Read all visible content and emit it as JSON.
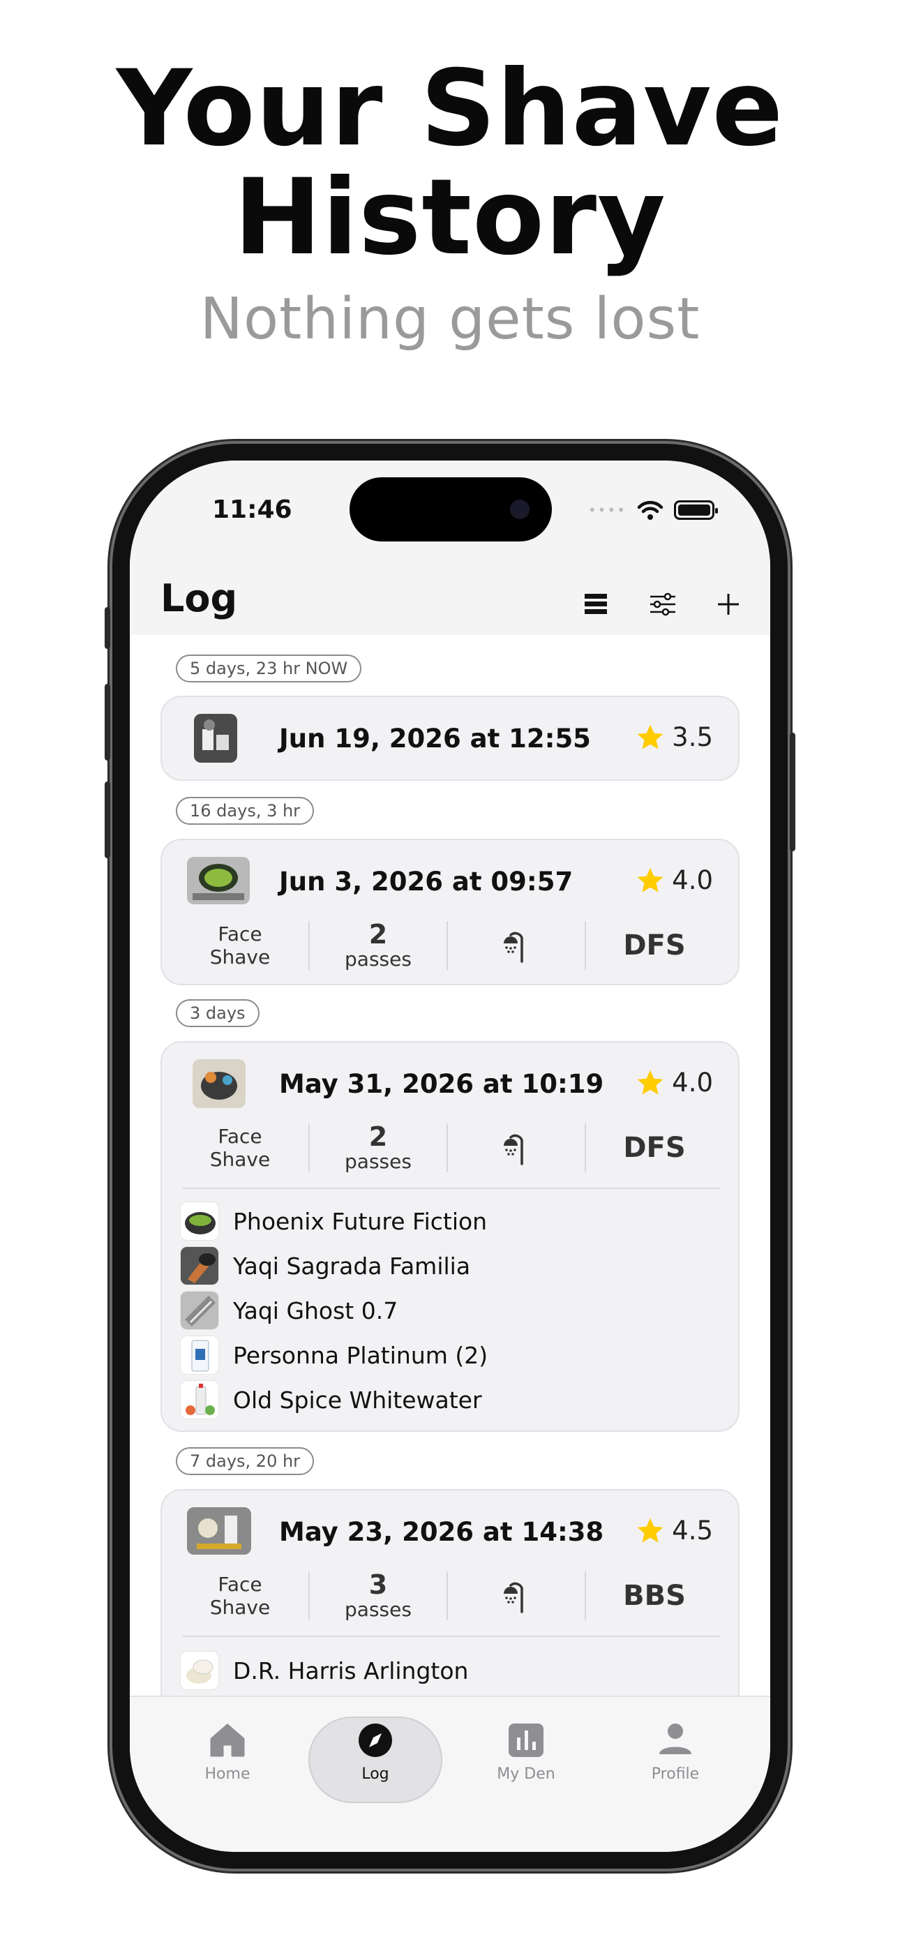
{
  "hero": {
    "title_line1": "Your Shave",
    "title_line2": "History",
    "subtitle": "Nothing gets lost"
  },
  "status_bar": {
    "time": "11:46"
  },
  "nav": {
    "title": "Log"
  },
  "entries": [
    {
      "gap_label": "5 days, 23 hr NOW",
      "date": "Jun 19, 2026 at 12:55",
      "rating": "3.5"
    },
    {
      "gap_label": "16 days, 3 hr",
      "date": "Jun 3, 2026 at 09:57",
      "rating": "4.0",
      "type_line1": "Face",
      "type_line2": "Shave",
      "passes_count": "2",
      "passes_label": "passes",
      "grade": "DFS"
    },
    {
      "gap_label": "3 days",
      "date": "May 31, 2026 at 10:19",
      "rating": "4.0",
      "type_line1": "Face",
      "type_line2": "Shave",
      "passes_count": "2",
      "passes_label": "passes",
      "grade": "DFS",
      "products": [
        "Phoenix Future Fiction",
        "Yaqi Sagrada Familia",
        "Yaqi Ghost 0.7",
        "Personna Platinum (2)",
        "Old Spice Whitewater"
      ]
    },
    {
      "gap_label": "7 days, 20 hr",
      "date": "May 23, 2026 at 14:38",
      "rating": "4.5",
      "type_line1": "Face",
      "type_line2": "Shave",
      "passes_count": "3",
      "passes_label": "passes",
      "grade": "BBS",
      "products": [
        "D.R. Harris Arlington"
      ]
    }
  ],
  "tabs": {
    "home": "Home",
    "log": "Log",
    "den": "My Den",
    "profile": "Profile"
  },
  "colors": {
    "star": "#ffcc00",
    "card_bg": "#f2f2f5",
    "accent": "#111111"
  }
}
